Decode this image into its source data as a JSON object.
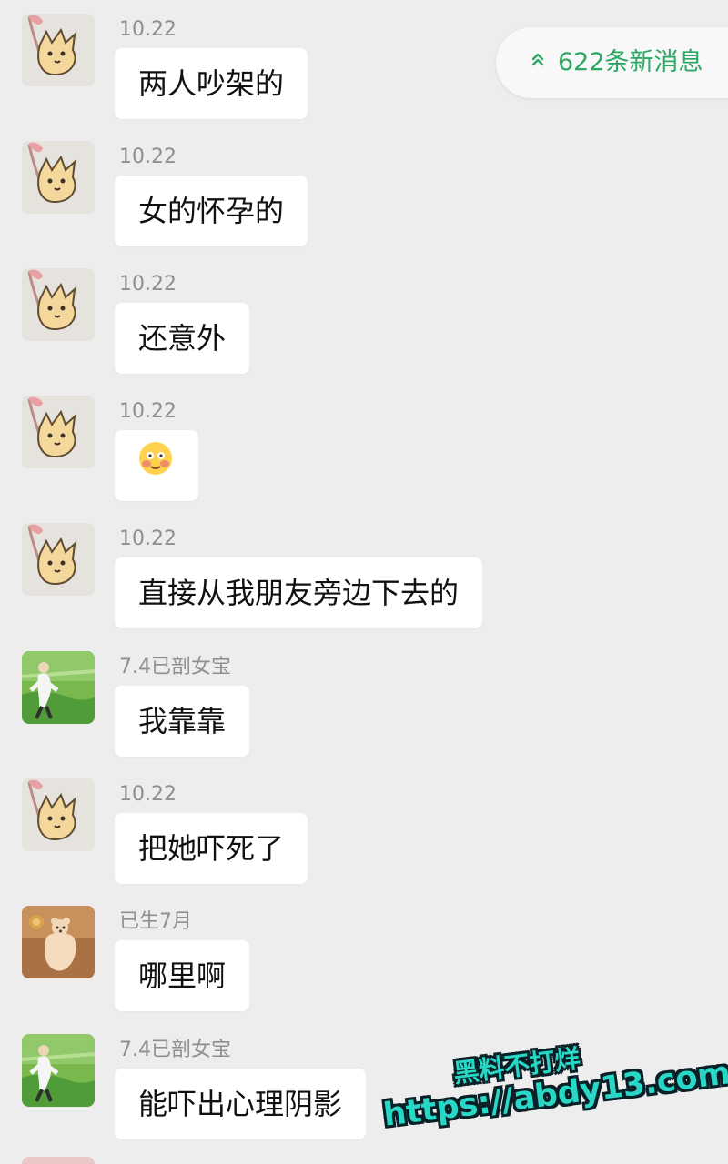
{
  "accent": "#2aa864",
  "new_messages": {
    "label": "622条新消息",
    "icon": "double-chevron-up-icon"
  },
  "messages": [
    {
      "sender": "10.22",
      "text": "两人吵架的",
      "avatar": "cat-avatar-icon"
    },
    {
      "sender": "10.22",
      "text": "女的怀孕的",
      "avatar": "cat-avatar-icon"
    },
    {
      "sender": "10.22",
      "text": "还意外",
      "avatar": "cat-avatar-icon"
    },
    {
      "sender": "10.22",
      "text": "",
      "avatar": "cat-avatar-icon",
      "emoji": "blushing-face-emoji"
    },
    {
      "sender": "10.22",
      "text": "直接从我朋友旁边下去的",
      "avatar": "cat-avatar-icon"
    },
    {
      "sender": "7.4已剖女宝",
      "text": "我靠靠",
      "avatar": "baseball-player-avatar-icon"
    },
    {
      "sender": "10.22",
      "text": "把她吓死了",
      "avatar": "cat-avatar-icon"
    },
    {
      "sender": "已生7月",
      "text": "哪里啊",
      "avatar": "bear-avatar-icon"
    },
    {
      "sender": "7.4已剖女宝",
      "text": "能吓出心理阴影",
      "avatar": "baseball-player-avatar-icon"
    }
  ],
  "watermark": {
    "line1": "黑料不打烊",
    "line2": "https://abdy13.com"
  }
}
